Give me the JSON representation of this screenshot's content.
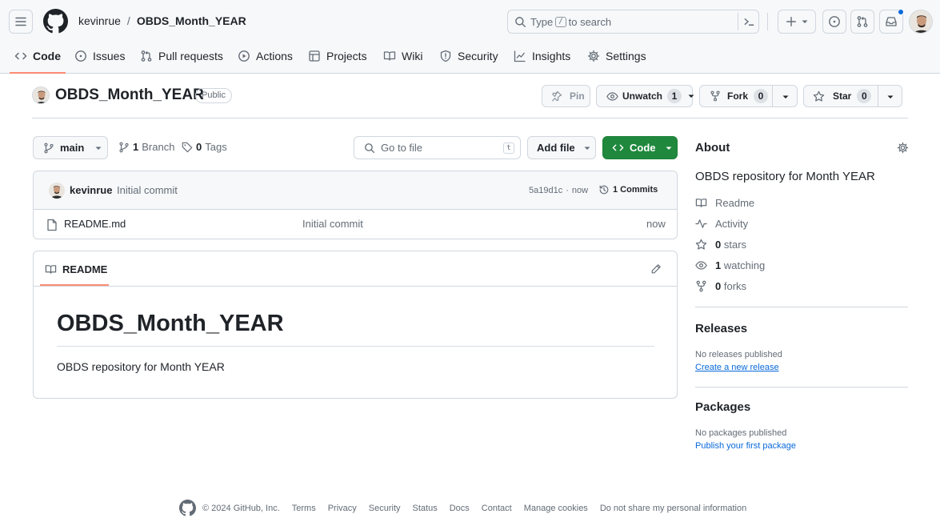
{
  "header": {
    "owner": "kevinrue",
    "separator": "/",
    "repo": "OBDS_Month_YEAR",
    "search_prefix": "Type",
    "search_key": "/",
    "search_suffix": "to search"
  },
  "nav": {
    "code": "Code",
    "issues": "Issues",
    "pulls": "Pull requests",
    "actions": "Actions",
    "projects": "Projects",
    "wiki": "Wiki",
    "security": "Security",
    "insights": "Insights",
    "settings": "Settings"
  },
  "repo": {
    "name": "OBDS_Month_YEAR",
    "visibility": "Public",
    "pin": "Pin",
    "unwatch": "Unwatch",
    "watch_count": "1",
    "fork": "Fork",
    "fork_count": "0",
    "star": "Star",
    "star_count": "0"
  },
  "toolbar": {
    "branch": "main",
    "branch_count": "1",
    "branch_label": "Branch",
    "tag_count": "0",
    "tag_label": "Tags",
    "goto_placeholder": "Go to file",
    "goto_key": "t",
    "add_file": "Add file",
    "code": "Code"
  },
  "commit": {
    "author": "kevinrue",
    "message": "Initial commit",
    "sha": "5a19d1c",
    "dot": "·",
    "time": "now",
    "commits": "1 Commits"
  },
  "files": [
    {
      "name": "README.md",
      "message": "Initial commit",
      "time": "now"
    }
  ],
  "readme": {
    "tab": "README",
    "title": "OBDS_Month_YEAR",
    "body": "OBDS repository for Month YEAR"
  },
  "about": {
    "heading": "About",
    "description": "OBDS repository for Month YEAR",
    "readme": "Readme",
    "activity": "Activity",
    "stars_count": "0",
    "stars_label": "stars",
    "watching_count": "1",
    "watching_label": "watching",
    "forks_count": "0",
    "forks_label": "forks"
  },
  "releases": {
    "heading": "Releases",
    "empty": "No releases published",
    "create": "Create a new release"
  },
  "packages": {
    "heading": "Packages",
    "empty": "No packages published",
    "publish": "Publish your first package"
  },
  "footer": {
    "copyright": "© 2024 GitHub, Inc.",
    "links": [
      "Terms",
      "Privacy",
      "Security",
      "Status",
      "Docs",
      "Contact",
      "Manage cookies",
      "Do not share my personal information"
    ]
  },
  "colors": {
    "accent": "#0969da",
    "primary_button": "#1f883d",
    "tab_underline": "#fd8c73",
    "notification_dot": "#0969da"
  }
}
